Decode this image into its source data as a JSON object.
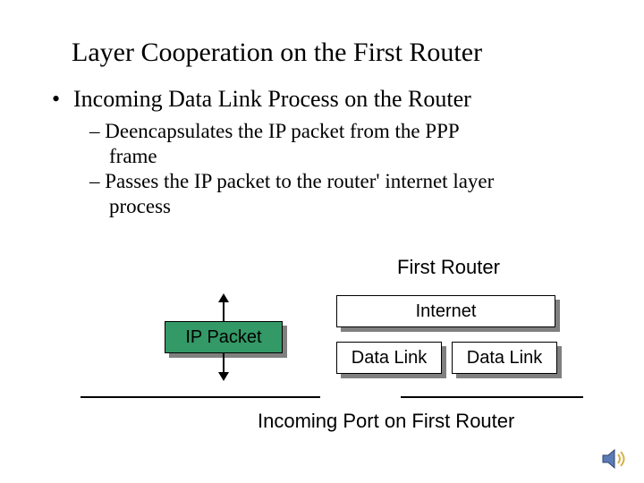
{
  "title": "Layer Cooperation on the First Router",
  "bullet": {
    "marker": "•",
    "text": "Incoming Data Link Process on the Router"
  },
  "subitems": {
    "marker1": "–",
    "line1a": "Deencapsulates the IP packet from the PPP",
    "line1b": "frame",
    "marker2": "–",
    "line2a": "Passes the IP packet to the router' internet layer",
    "line2b": "process"
  },
  "diagram": {
    "first_router": "First Router",
    "ip_packet": "IP Packet",
    "internet": "Internet",
    "data_link_left": "Data Link",
    "data_link_right": "Data Link",
    "incoming_port": "Incoming Port on First Router"
  },
  "icon": {
    "speaker": "speaker-icon"
  }
}
